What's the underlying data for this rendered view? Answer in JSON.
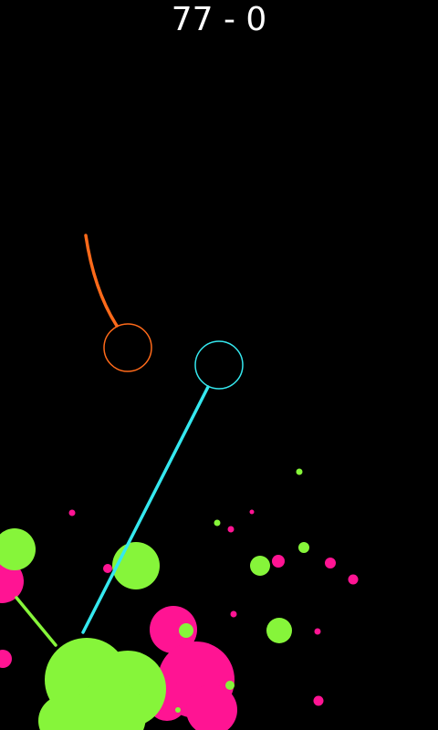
{
  "score": {
    "text": "77 - 0"
  },
  "colors": {
    "background": "#000000",
    "score_text": "#ffffff",
    "player_orange": "#ff6a1a",
    "player_cyan": "#35e8ef",
    "paint_lime": "#86f53a",
    "paint_magenta": "#ff1493"
  },
  "scene": {
    "players": [
      {
        "name": "orange-ball-player",
        "color_key": "player_orange"
      },
      {
        "name": "cyan-ball-player",
        "color_key": "player_cyan"
      }
    ],
    "tethers": [
      {
        "name": "orange-ball-trail",
        "color_key": "player_orange"
      },
      {
        "name": "cyan-ball-tether",
        "color_key": "player_cyan"
      },
      {
        "name": "lime-ball-tether",
        "color_key": "paint_lime"
      }
    ],
    "paint_colors": [
      "paint_lime",
      "paint_magenta"
    ]
  }
}
